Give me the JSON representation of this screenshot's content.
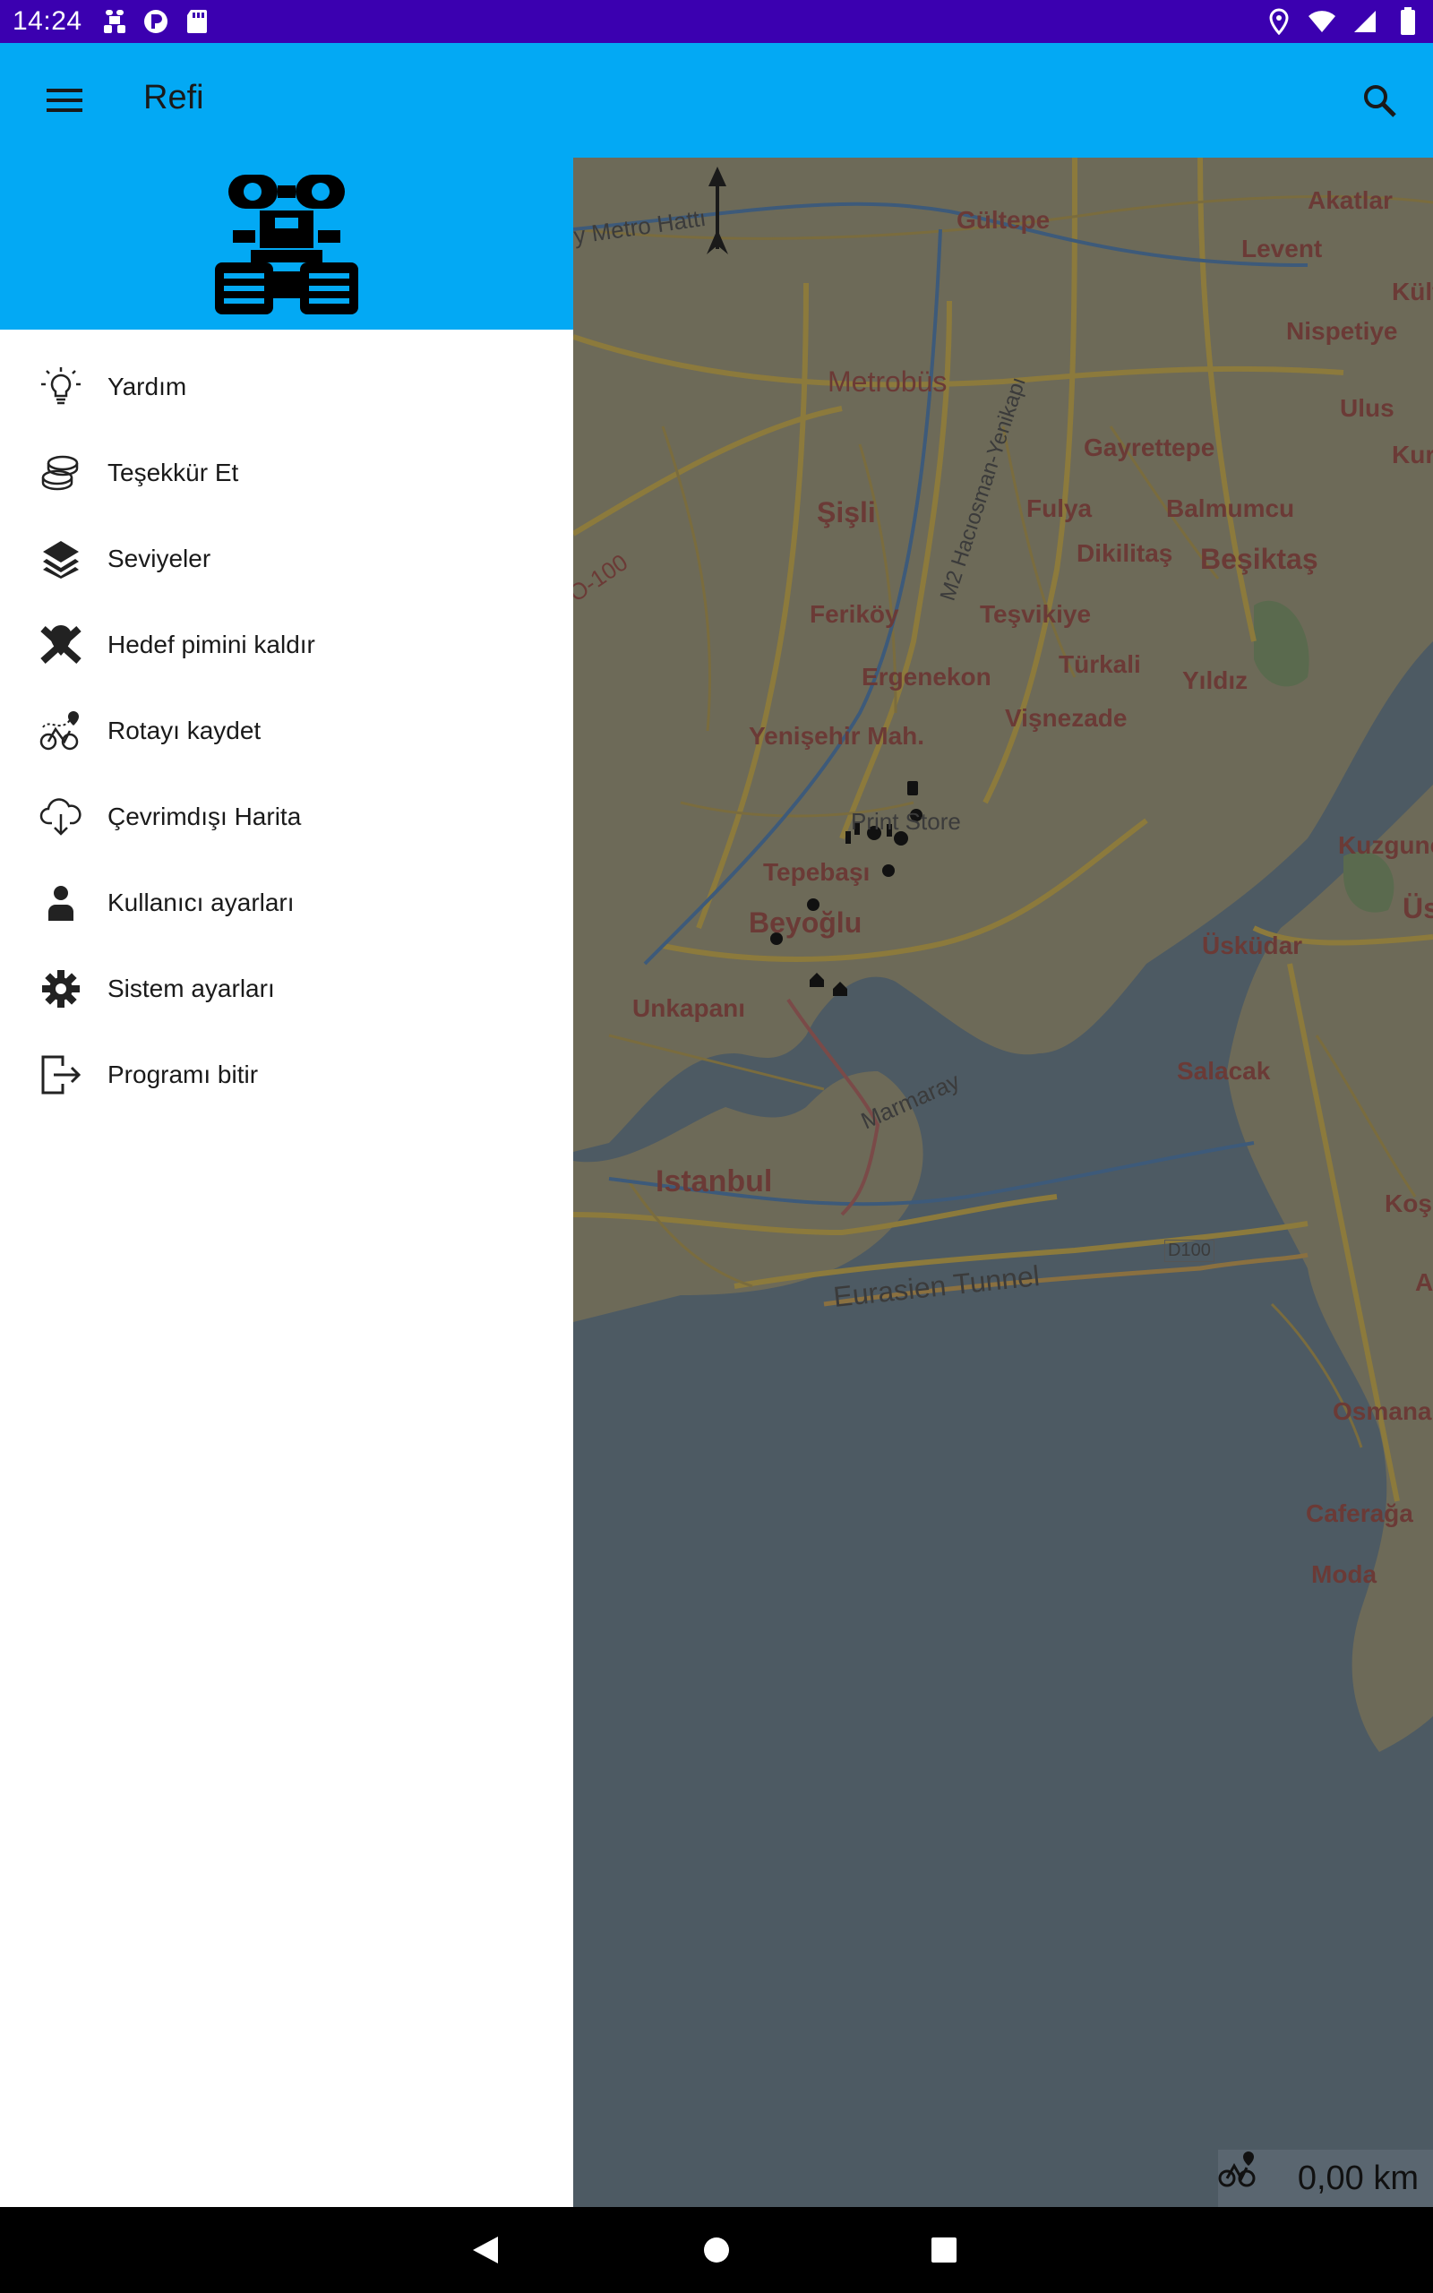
{
  "status_bar": {
    "time": "14:24",
    "left_icons": [
      "robot-icon",
      "p-badge-icon",
      "sd-card-icon"
    ],
    "right_icons": [
      "location-icon",
      "wifi-icon",
      "signal-icon",
      "battery-icon"
    ]
  },
  "app_bar": {
    "title": "Refi",
    "menu_icon": "hamburger-menu-icon",
    "search_icon": "search-icon",
    "color": "#03a9f4"
  },
  "drawer": {
    "header_logo": "robot-logo",
    "items": [
      {
        "label": "Yardım",
        "icon": "lightbulb-icon"
      },
      {
        "label": "Teşekkür Et",
        "icon": "coins-icon"
      },
      {
        "label": "Seviyeler",
        "icon": "layers-icon"
      },
      {
        "label": "Hedef pimini kaldır",
        "icon": "remove-pin-icon"
      },
      {
        "label": "Rotayı kaydet",
        "icon": "bike-route-icon"
      },
      {
        "label": "Çevrimdışı Harita",
        "icon": "cloud-download-icon"
      },
      {
        "label": "Kullanıcı ayarları",
        "icon": "person-icon"
      },
      {
        "label": "Sistem ayarları",
        "icon": "gear-icon"
      },
      {
        "label": "Programı bitir",
        "icon": "exit-icon"
      }
    ]
  },
  "map": {
    "labels": {
      "akatlar": "Akatlar",
      "gultepe": "Gültepe",
      "levent": "Levent",
      "kultur": "Kültür",
      "nispetiye": "Nispetiye",
      "ulus": "Ulus",
      "kur": "Kur",
      "metrobus": "Metrobüs",
      "gayrettepe": "Gayrettepe",
      "sisli": "Şişli",
      "fulya": "Fulya",
      "balmumcu": "Balmumcu",
      "dikilitas": "Dikilitaş",
      "besiktas": "Beşiktaş",
      "ferikoy": "Feriköy",
      "tesvikiye": "Teşvikiye",
      "turkali": "Türkali",
      "yildiz": "Yıldız",
      "ergenekon": "Ergenekon",
      "visnezade": "Vişnezade",
      "yenisehir": "Yenişehir Mah.",
      "print_store": "Print Store",
      "kuzgunc": "Kuzgunc",
      "tepebasi": "Tepebaşı",
      "beyoglu": "Beyoğlu",
      "usku": "Üsku",
      "uskudar": "Üsküdar",
      "unkapani": "Unkapanı",
      "salacak": "Salacak",
      "istanbul": "Istanbul",
      "kos": "Koşu",
      "a": "A",
      "osmana": "Osmana",
      "caferaga": "Caferağa",
      "moda": "Moda"
    },
    "roads": {
      "metro_hatti": "y Metro Hattı",
      "o100": "O-100",
      "m2": "M2 Hacıosman-Yenikapı",
      "marmaray": "Marmaray",
      "eurasien": "Eurasien Tunnel",
      "d100": "D100"
    },
    "distance": "0,00 km",
    "distance_icon": "bike-route-icon",
    "compass_icon": "north-arrow-icon"
  },
  "nav_bar": {
    "buttons": [
      "back-icon",
      "home-icon",
      "recents-icon"
    ]
  }
}
